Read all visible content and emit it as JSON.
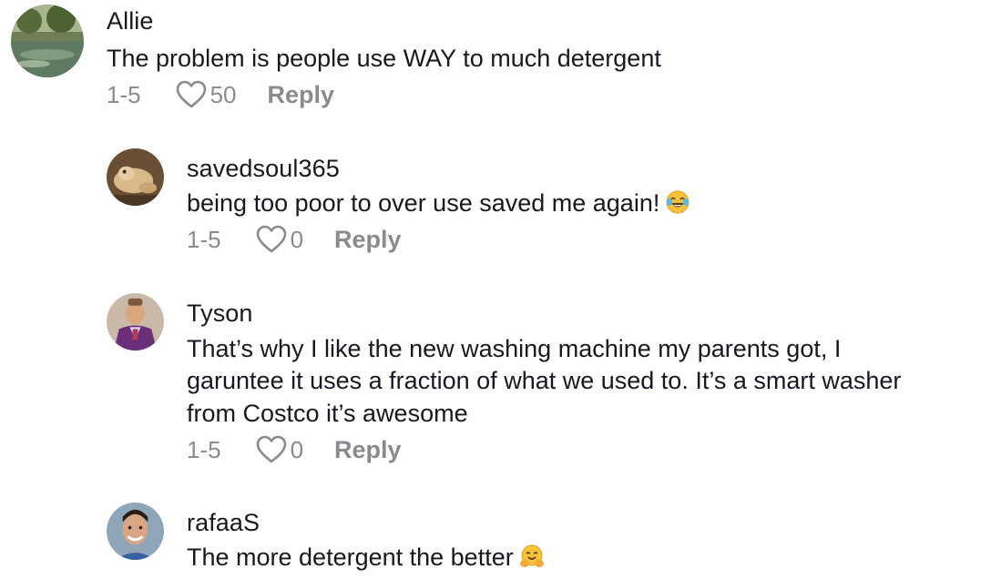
{
  "comments": [
    {
      "username": "Allie",
      "text_lines": [
        "The problem is people use WAY to much detergent"
      ],
      "date": "1-5",
      "likes": "50",
      "reply_label": "Reply",
      "emoji": ""
    },
    {
      "username": "savedsoul365",
      "text_lines": [
        "being too poor to over use saved me again!"
      ],
      "date": "1-5",
      "likes": "0",
      "reply_label": "Reply",
      "emoji": "tears-of-joy"
    },
    {
      "username": "Tyson",
      "text_lines": [
        "That’s why I like the new washing machine my parents got, I",
        "garuntee it uses a fraction of what we used to. It’s a smart washer",
        "from Costco it’s awesome"
      ],
      "date": "1-5",
      "likes": "0",
      "reply_label": "Reply",
      "emoji": ""
    },
    {
      "username": "rafaaS",
      "text_lines": [
        "The more detergent the better"
      ],
      "emoji": "hugging-face"
    }
  ],
  "icons": {
    "like": "heart-outline-icon",
    "tears_of_joy": "face-with-tears-of-joy-emoji",
    "hugging": "hugging-face-emoji"
  },
  "colors": {
    "text": "#161823",
    "secondary": "#8a8b91",
    "background": "#ffffff"
  }
}
